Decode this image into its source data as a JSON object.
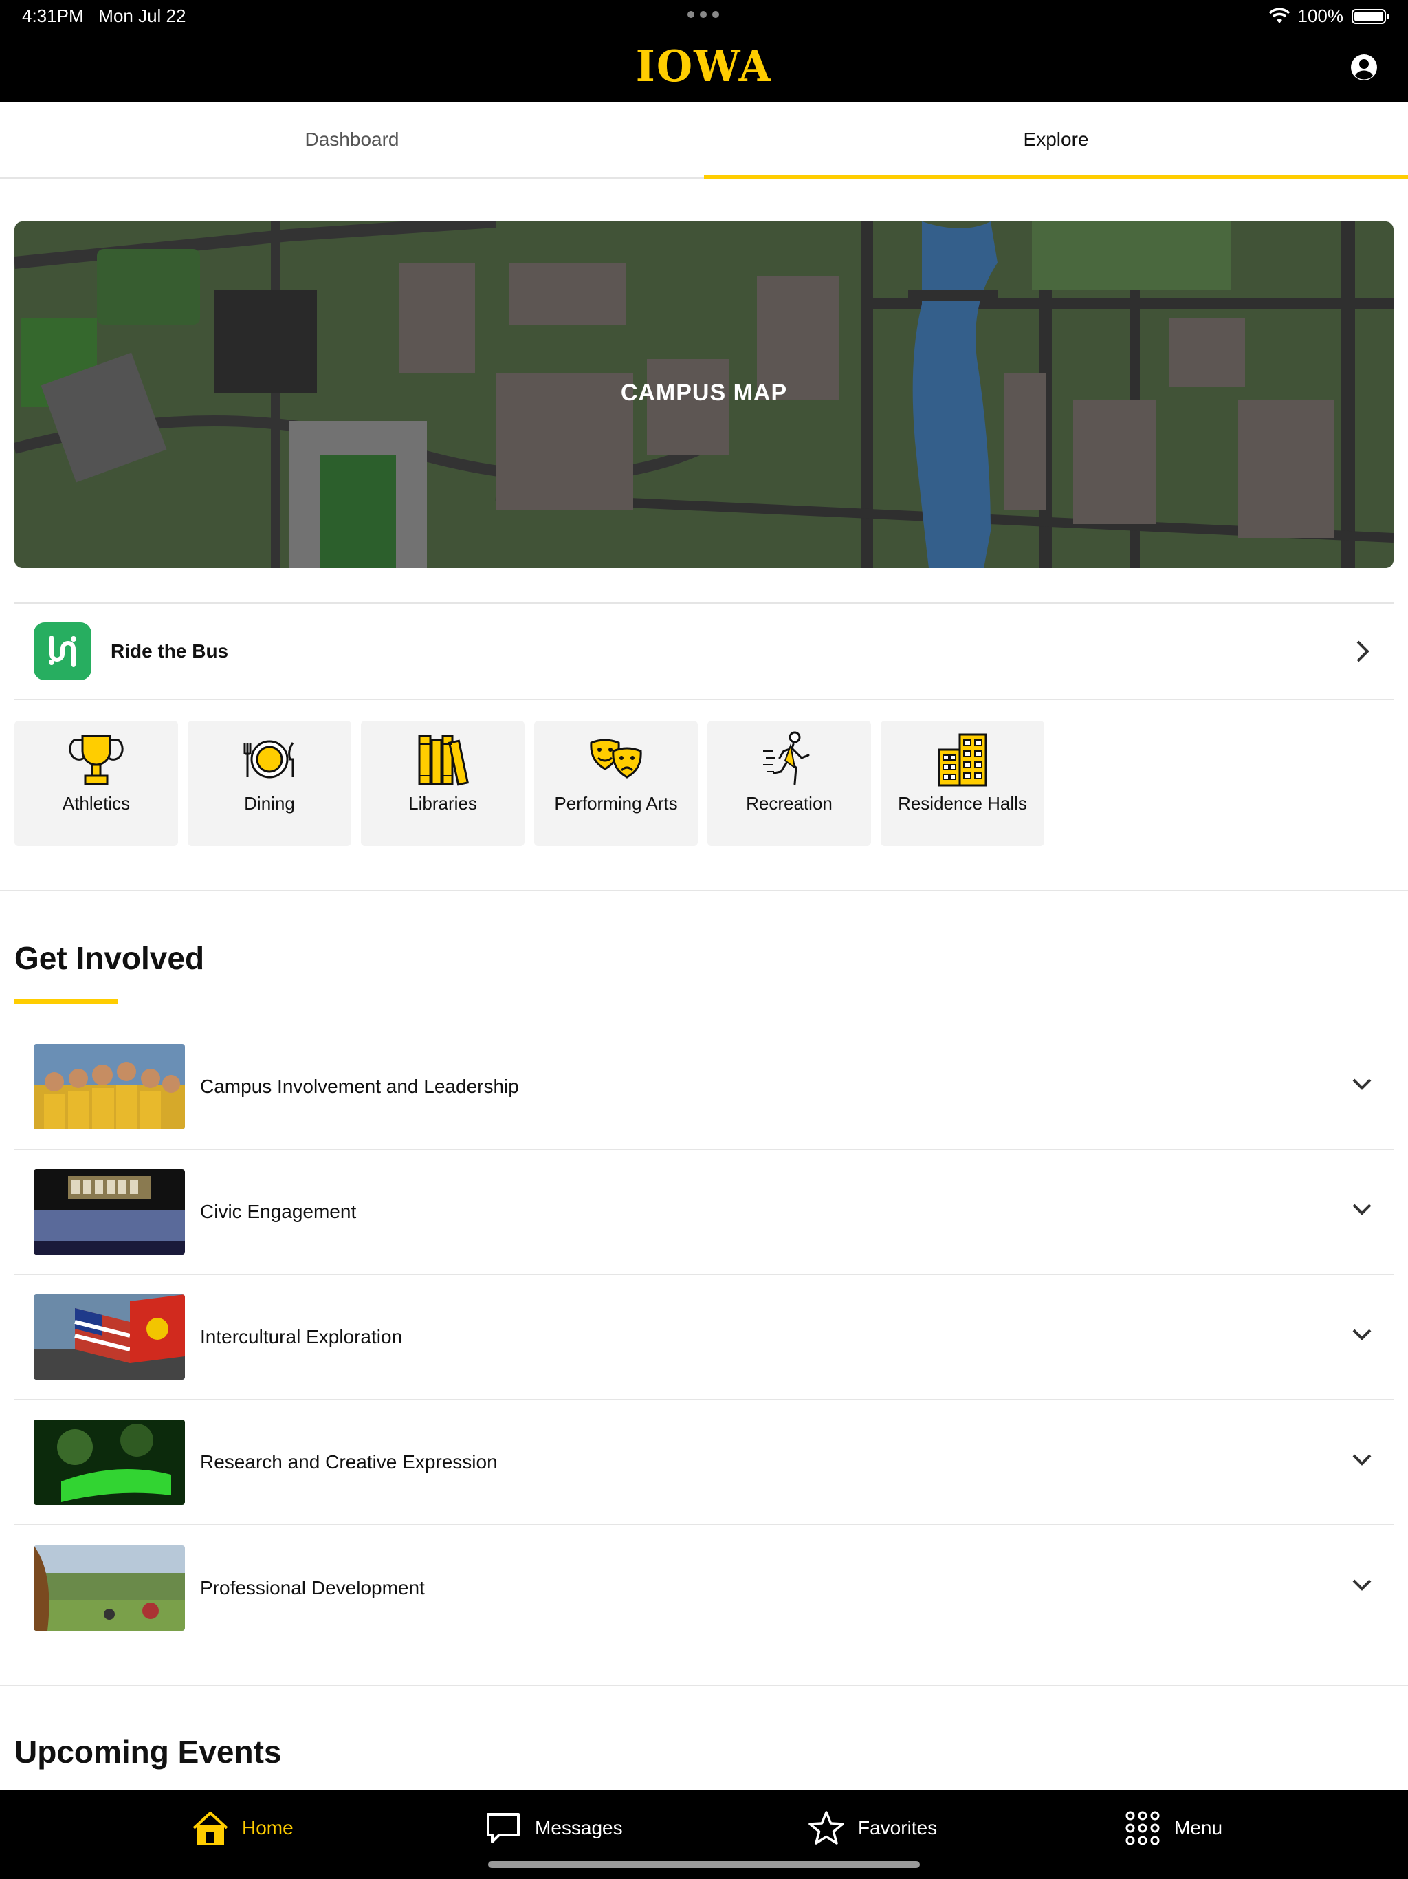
{
  "status": {
    "time": "4:31PM",
    "date": "Mon Jul 22",
    "battery": "100%"
  },
  "header": {
    "logo": "IOWA",
    "profile_icon": "profile-icon"
  },
  "tabs": [
    {
      "label": "Dashboard",
      "active": false
    },
    {
      "label": "Explore",
      "active": true
    }
  ],
  "map": {
    "label": "CAMPUS MAP"
  },
  "bus": {
    "label": "Ride the Bus",
    "icon": "bus-app-icon"
  },
  "categories": [
    {
      "label": "Athletics",
      "icon": "trophy-icon"
    },
    {
      "label": "Dining",
      "icon": "plate-icon"
    },
    {
      "label": "Libraries",
      "icon": "books-icon"
    },
    {
      "label": "Performing Arts",
      "icon": "theater-masks-icon"
    },
    {
      "label": "Recreation",
      "icon": "runner-icon"
    },
    {
      "label": "Residence Halls",
      "icon": "building-icon"
    }
  ],
  "get_involved": {
    "title": "Get Involved",
    "items": [
      {
        "label": "Campus Involvement and Leadership"
      },
      {
        "label": "Civic Engagement"
      },
      {
        "label": "Intercultural Exploration"
      },
      {
        "label": "Research and Creative Expression"
      },
      {
        "label": "Professional Development"
      }
    ]
  },
  "upcoming": {
    "title": "Upcoming Events"
  },
  "nav": [
    {
      "label": "Home",
      "icon": "home-icon",
      "active": true
    },
    {
      "label": "Messages",
      "icon": "message-icon",
      "active": false
    },
    {
      "label": "Favorites",
      "icon": "star-icon",
      "active": false
    },
    {
      "label": "Menu",
      "icon": "grid-icon",
      "active": false
    }
  ],
  "colors": {
    "accent": "#FFCD00",
    "header_bg": "#000000",
    "bus_green": "#27AE60"
  }
}
